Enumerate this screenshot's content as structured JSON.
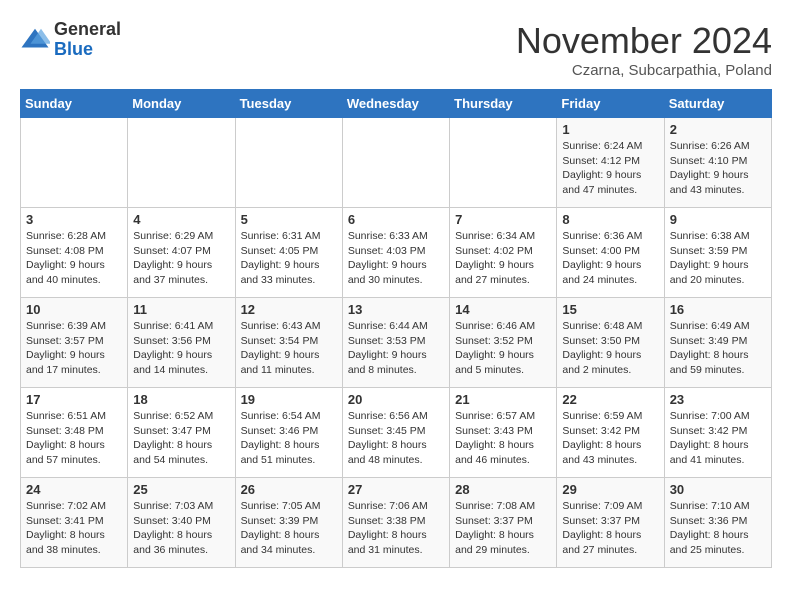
{
  "logo": {
    "general": "General",
    "blue": "Blue"
  },
  "title": "November 2024",
  "subtitle": "Czarna, Subcarpathia, Poland",
  "days_of_week": [
    "Sunday",
    "Monday",
    "Tuesday",
    "Wednesday",
    "Thursday",
    "Friday",
    "Saturday"
  ],
  "weeks": [
    [
      {
        "day": "",
        "info": ""
      },
      {
        "day": "",
        "info": ""
      },
      {
        "day": "",
        "info": ""
      },
      {
        "day": "",
        "info": ""
      },
      {
        "day": "",
        "info": ""
      },
      {
        "day": "1",
        "info": "Sunrise: 6:24 AM\nSunset: 4:12 PM\nDaylight: 9 hours\nand 47 minutes."
      },
      {
        "day": "2",
        "info": "Sunrise: 6:26 AM\nSunset: 4:10 PM\nDaylight: 9 hours\nand 43 minutes."
      }
    ],
    [
      {
        "day": "3",
        "info": "Sunrise: 6:28 AM\nSunset: 4:08 PM\nDaylight: 9 hours\nand 40 minutes."
      },
      {
        "day": "4",
        "info": "Sunrise: 6:29 AM\nSunset: 4:07 PM\nDaylight: 9 hours\nand 37 minutes."
      },
      {
        "day": "5",
        "info": "Sunrise: 6:31 AM\nSunset: 4:05 PM\nDaylight: 9 hours\nand 33 minutes."
      },
      {
        "day": "6",
        "info": "Sunrise: 6:33 AM\nSunset: 4:03 PM\nDaylight: 9 hours\nand 30 minutes."
      },
      {
        "day": "7",
        "info": "Sunrise: 6:34 AM\nSunset: 4:02 PM\nDaylight: 9 hours\nand 27 minutes."
      },
      {
        "day": "8",
        "info": "Sunrise: 6:36 AM\nSunset: 4:00 PM\nDaylight: 9 hours\nand 24 minutes."
      },
      {
        "day": "9",
        "info": "Sunrise: 6:38 AM\nSunset: 3:59 PM\nDaylight: 9 hours\nand 20 minutes."
      }
    ],
    [
      {
        "day": "10",
        "info": "Sunrise: 6:39 AM\nSunset: 3:57 PM\nDaylight: 9 hours\nand 17 minutes."
      },
      {
        "day": "11",
        "info": "Sunrise: 6:41 AM\nSunset: 3:56 PM\nDaylight: 9 hours\nand 14 minutes."
      },
      {
        "day": "12",
        "info": "Sunrise: 6:43 AM\nSunset: 3:54 PM\nDaylight: 9 hours\nand 11 minutes."
      },
      {
        "day": "13",
        "info": "Sunrise: 6:44 AM\nSunset: 3:53 PM\nDaylight: 9 hours\nand 8 minutes."
      },
      {
        "day": "14",
        "info": "Sunrise: 6:46 AM\nSunset: 3:52 PM\nDaylight: 9 hours\nand 5 minutes."
      },
      {
        "day": "15",
        "info": "Sunrise: 6:48 AM\nSunset: 3:50 PM\nDaylight: 9 hours\nand 2 minutes."
      },
      {
        "day": "16",
        "info": "Sunrise: 6:49 AM\nSunset: 3:49 PM\nDaylight: 8 hours\nand 59 minutes."
      }
    ],
    [
      {
        "day": "17",
        "info": "Sunrise: 6:51 AM\nSunset: 3:48 PM\nDaylight: 8 hours\nand 57 minutes."
      },
      {
        "day": "18",
        "info": "Sunrise: 6:52 AM\nSunset: 3:47 PM\nDaylight: 8 hours\nand 54 minutes."
      },
      {
        "day": "19",
        "info": "Sunrise: 6:54 AM\nSunset: 3:46 PM\nDaylight: 8 hours\nand 51 minutes."
      },
      {
        "day": "20",
        "info": "Sunrise: 6:56 AM\nSunset: 3:45 PM\nDaylight: 8 hours\nand 48 minutes."
      },
      {
        "day": "21",
        "info": "Sunrise: 6:57 AM\nSunset: 3:43 PM\nDaylight: 8 hours\nand 46 minutes."
      },
      {
        "day": "22",
        "info": "Sunrise: 6:59 AM\nSunset: 3:42 PM\nDaylight: 8 hours\nand 43 minutes."
      },
      {
        "day": "23",
        "info": "Sunrise: 7:00 AM\nSunset: 3:42 PM\nDaylight: 8 hours\nand 41 minutes."
      }
    ],
    [
      {
        "day": "24",
        "info": "Sunrise: 7:02 AM\nSunset: 3:41 PM\nDaylight: 8 hours\nand 38 minutes."
      },
      {
        "day": "25",
        "info": "Sunrise: 7:03 AM\nSunset: 3:40 PM\nDaylight: 8 hours\nand 36 minutes."
      },
      {
        "day": "26",
        "info": "Sunrise: 7:05 AM\nSunset: 3:39 PM\nDaylight: 8 hours\nand 34 minutes."
      },
      {
        "day": "27",
        "info": "Sunrise: 7:06 AM\nSunset: 3:38 PM\nDaylight: 8 hours\nand 31 minutes."
      },
      {
        "day": "28",
        "info": "Sunrise: 7:08 AM\nSunset: 3:37 PM\nDaylight: 8 hours\nand 29 minutes."
      },
      {
        "day": "29",
        "info": "Sunrise: 7:09 AM\nSunset: 3:37 PM\nDaylight: 8 hours\nand 27 minutes."
      },
      {
        "day": "30",
        "info": "Sunrise: 7:10 AM\nSunset: 3:36 PM\nDaylight: 8 hours\nand 25 minutes."
      }
    ]
  ]
}
